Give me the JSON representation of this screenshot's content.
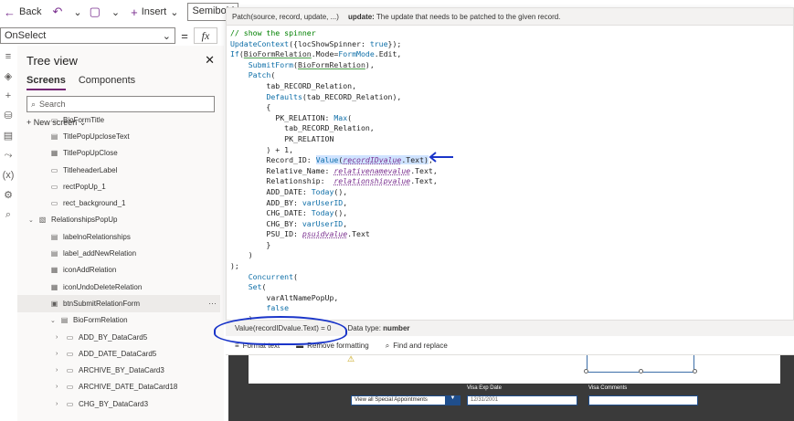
{
  "toolbar": {
    "back_label": "Back",
    "insert_label": "Insert",
    "font_value": "Semibold"
  },
  "property": {
    "selected": "OnSelect",
    "equals": "=",
    "fx": "fx"
  },
  "tree": {
    "title": "Tree view",
    "tabs": [
      "Screens",
      "Components"
    ],
    "search_placeholder": "Search",
    "new_screen_label": "New screen",
    "nodes": [
      {
        "label": "BioFormTitle",
        "indent": 1
      },
      {
        "label": "TitlePopUpcloseText",
        "indent": 1
      },
      {
        "label": "TitlePopUpClose",
        "indent": 1
      },
      {
        "label": "TitleheaderLabel",
        "indent": 1
      },
      {
        "label": "rectPopUp_1",
        "indent": 1
      },
      {
        "label": "rect_background_1",
        "indent": 1
      },
      {
        "label": "RelationshipsPopUp",
        "indent": 0
      },
      {
        "label": "labelnoRelationships",
        "indent": 1
      },
      {
        "label": "label_addNewRelation",
        "indent": 1
      },
      {
        "label": "iconAddRelation",
        "indent": 1
      },
      {
        "label": "iconUndoDeleteRelation",
        "indent": 1
      },
      {
        "label": "btnSubmitRelationForm",
        "indent": 1
      },
      {
        "label": "BioFormRelation",
        "indent": 1
      },
      {
        "label": "ADD_BY_DataCard5",
        "indent": 2
      },
      {
        "label": "ADD_DATE_DataCard5",
        "indent": 2
      },
      {
        "label": "ARCHIVE_BY_DataCard3",
        "indent": 2
      },
      {
        "label": "ARCHIVE_DATE_DataCard18",
        "indent": 2
      },
      {
        "label": "CHG_BY_DataCard3",
        "indent": 2
      }
    ]
  },
  "formula": {
    "signature": "Patch(source, record, update, ...)",
    "hint_param": "update:",
    "hint_text": "The update that needs to be patched to the given record.",
    "result_expr": "Value(recordIDvalue.Text)  =  0",
    "data_type_label": "Data type:",
    "data_type_value": "number",
    "format_text": "Format text",
    "remove_formatting": "Remove formatting",
    "find_replace": "Find and replace"
  },
  "canvas": {
    "dropdown_value": "View all Special Appointments",
    "visa_exp_label": "Visa Exp Date",
    "visa_exp_value": "12/31/2001",
    "visa_comments_label": "Visa Comments"
  },
  "colors": {
    "accent": "#742774",
    "annotation_blue": "#1a35c9",
    "canvas_dark": "#3a3a3a"
  }
}
